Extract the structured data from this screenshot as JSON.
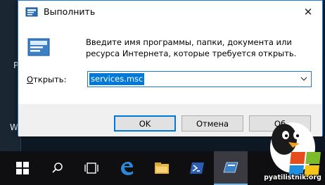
{
  "dialog": {
    "title": "Выполнить",
    "close_glyph": "✕",
    "description": "Введите имя программы, папки, документа или ресурса Интернета, которые требуется открыть.",
    "open_label_accel": "О",
    "open_label_rest": "ткрыть:",
    "input_value": "services.msc",
    "ok_label": "OK",
    "cancel_label": "Отмена",
    "browse_label": "Об"
  },
  "background": {
    "edge_letters": [
      "P",
      "W"
    ]
  },
  "taskbar": {
    "items": [
      "windows-start",
      "search",
      "task-view",
      "edge",
      "file-explorer",
      "powershell",
      "run"
    ]
  },
  "watermark": {
    "text": "pyatilistnik.org"
  }
}
